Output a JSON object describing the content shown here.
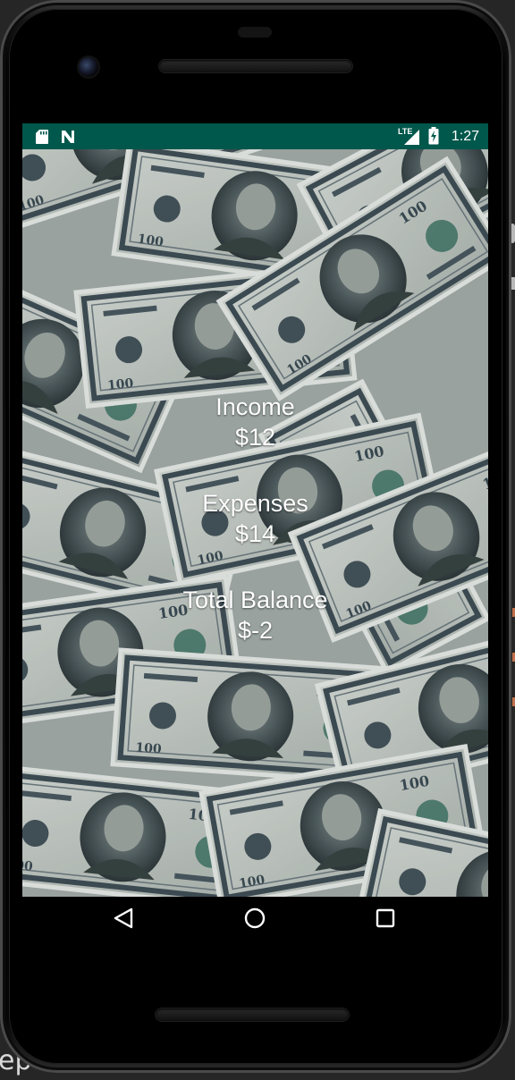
{
  "device": {
    "status_bar": {
      "time": "1:27",
      "network": "LTE",
      "icons": [
        "sd-card-icon",
        "n-notification-icon",
        "lte-signal-icon",
        "battery-charging-icon"
      ],
      "background_color": "#00574b"
    },
    "navigation": {
      "back": "back-triangle-icon",
      "home": "home-circle-icon",
      "recents": "recents-square-icon"
    }
  },
  "app": {
    "background": "dollar-bills-image",
    "summary": {
      "income": {
        "label": "Income",
        "value": "$12"
      },
      "expenses": {
        "label": "Expenses",
        "value": "$14"
      },
      "balance": {
        "label": "Total Balance",
        "value": "$-2"
      }
    },
    "text_color": "#ffffff"
  }
}
